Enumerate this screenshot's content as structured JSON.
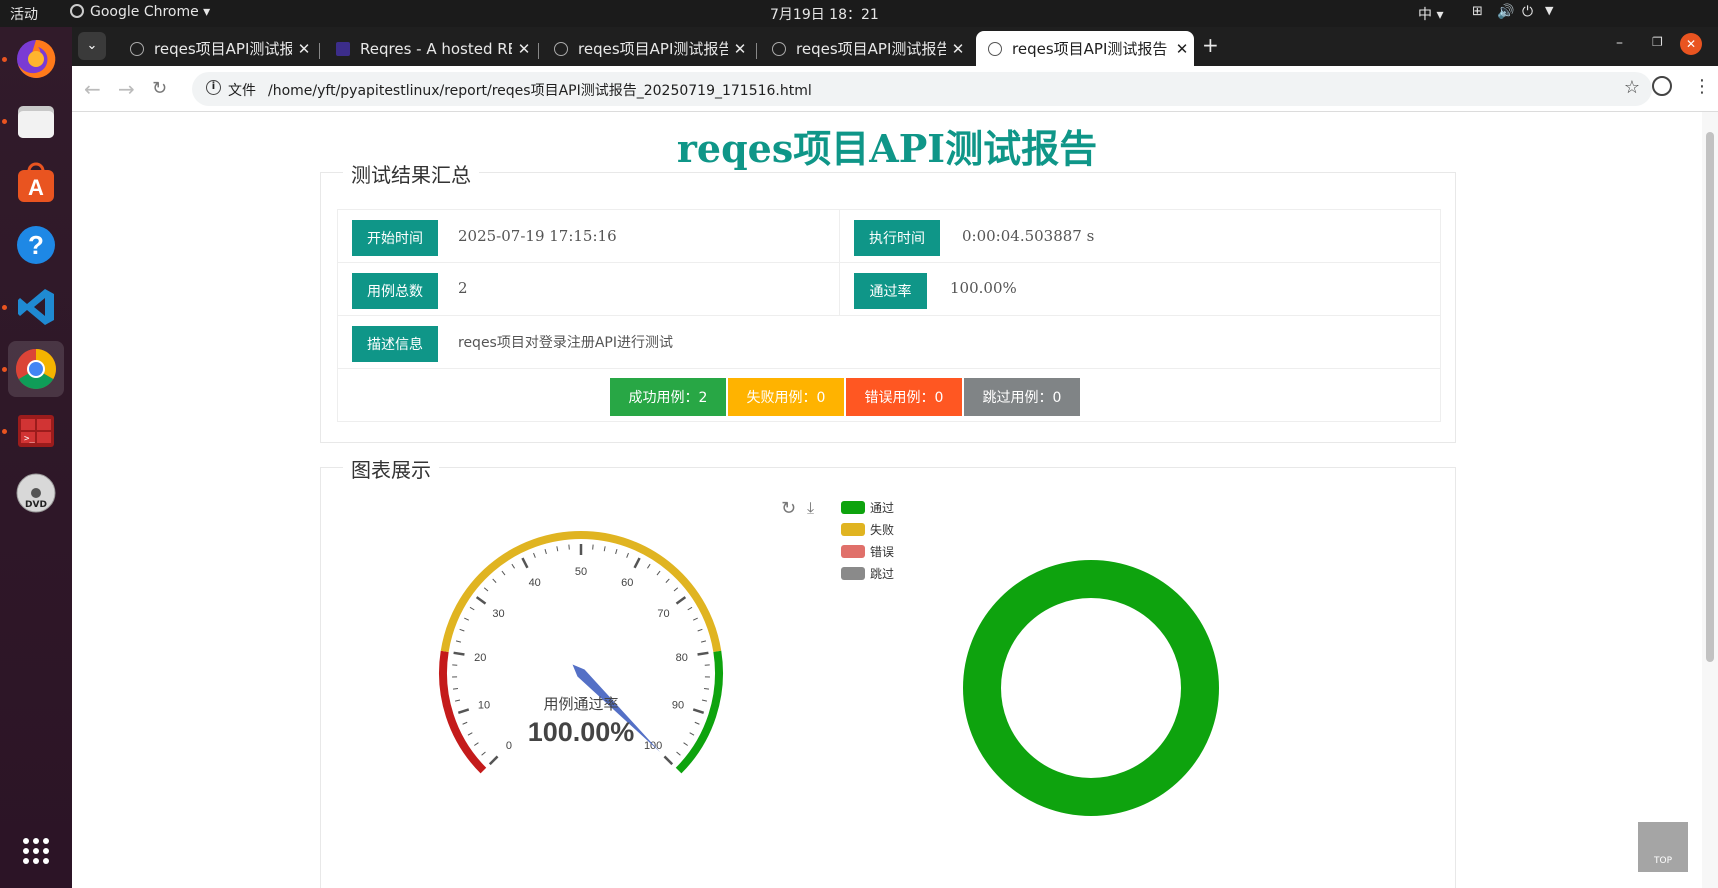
{
  "system_bar": {
    "activities": "活动",
    "app_menu": "Google Chrome",
    "clock": "7月19日  18：21",
    "input_method": "中"
  },
  "dock": {
    "items": [
      "firefox-icon",
      "files-icon",
      "app-center-icon",
      "help-icon",
      "vscode-icon",
      "chrome-icon",
      "terminal-app-icon",
      "dvd-icon"
    ],
    "show_apps_icon": "apps-grid-icon"
  },
  "browser": {
    "tabs": [
      {
        "title": "reqes项目API测试报告",
        "active": false
      },
      {
        "title": "Reqres - A hosted REST-API ready to respond to your AJAX requests",
        "active": false
      },
      {
        "title": "reqes项目API测试报告",
        "active": false
      },
      {
        "title": "reqes项目API测试报告",
        "active": false
      },
      {
        "title": "reqes项目API测试报告",
        "active": true
      }
    ],
    "new_tab": "+",
    "omnibox": {
      "chip": "文件",
      "url": "/home/yft/pyapitestlinux/report/reqes项目API测试报告_20250719_171516.html"
    }
  },
  "report": {
    "title": "reqes项目API测试报告",
    "summary": {
      "legend": "测试结果汇总",
      "start_time_label": "开始时间",
      "start_time": "2025-07-19 17:15:16",
      "duration_label": "执行时间",
      "duration": "0:00:04.503887 s",
      "total_label": "用例总数",
      "total": "2",
      "pass_rate_label": "通过率",
      "pass_rate": "100.00%",
      "description_label": "描述信息",
      "description": "reqes项目对登录注册API进行测试",
      "counts": [
        {
          "text": "成功用例：2",
          "color": "#28a745"
        },
        {
          "text": "失败用例：0",
          "color": "#ffb300"
        },
        {
          "text": "错误用例：0",
          "color": "#ff5722"
        },
        {
          "text": "跳过用例：0",
          "color": "#808486"
        }
      ]
    },
    "charts": {
      "legend": "图表展示",
      "gauge": {
        "label": "用例通过率",
        "value_text": "100.00%",
        "value": 100,
        "min": 0,
        "max": 100,
        "ticks": [
          "0",
          "10",
          "20",
          "30",
          "40",
          "50",
          "60",
          "70",
          "80",
          "90",
          "100"
        ],
        "band_colors": [
          "#c41b1b",
          "#e0b421",
          "#0ea30e"
        ]
      },
      "legend_items": [
        {
          "name": "通过",
          "color": "#0ea30e"
        },
        {
          "name": "失败",
          "color": "#e0b421"
        },
        {
          "name": "错误",
          "color": "#e0706a"
        },
        {
          "name": "跳过",
          "color": "#8a8a8a"
        }
      ],
      "donut": {
        "passed": 2,
        "failed": 0,
        "error": 0,
        "skipped": 0,
        "color": "#0ea30e"
      }
    },
    "back_to_top": "TOP"
  }
}
